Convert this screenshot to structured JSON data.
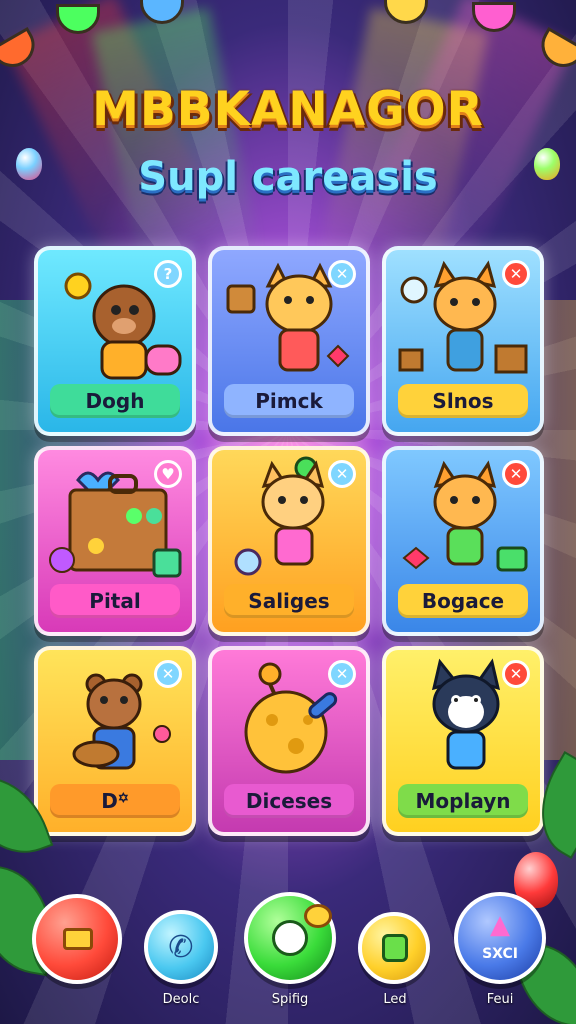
{
  "header": {
    "title": "MBBKANAGOR",
    "subtitle": "Supl careasis"
  },
  "colors": {
    "title_fill": "#ffd21f",
    "subtitle_fill": "#7ee8ff",
    "badge_blue": "#7fd6ff",
    "badge_red": "#ff4a3a",
    "badge_pink": "#ff7bd0"
  },
  "cards": [
    {
      "label": "Dogh",
      "badge": "?",
      "badge_icon": "help-icon",
      "theme": "cyan"
    },
    {
      "label": "Pimck",
      "badge": "✕",
      "badge_icon": "close-icon",
      "theme": "blue"
    },
    {
      "label": "Slnos",
      "badge": "✕",
      "badge_icon": "close-icon",
      "theme": "sky"
    },
    {
      "label": "Pital",
      "badge": "♥",
      "badge_icon": "heart-icon",
      "theme": "magenta"
    },
    {
      "label": "Saliges",
      "badge": "✕",
      "badge_icon": "close-icon",
      "theme": "orange"
    },
    {
      "label": "Bogace",
      "badge": "✕",
      "badge_icon": "close-icon",
      "theme": "azure"
    },
    {
      "label": "D꙳",
      "badge": "✕",
      "badge_icon": "close-icon",
      "theme": "yellow"
    },
    {
      "label": "Diceses",
      "badge": "✕",
      "badge_icon": "close-icon",
      "theme": "pink"
    },
    {
      "label": "Moplayn",
      "badge": "✕",
      "badge_icon": "close-icon",
      "theme": "lemon"
    }
  ],
  "nav": {
    "items": [
      {
        "label": "",
        "icon": "menu-icon"
      },
      {
        "label": "Deolc",
        "icon": "phone-icon"
      },
      {
        "label": "Spifig",
        "icon": "play-icon"
      },
      {
        "label": "Led",
        "icon": "refresh-icon"
      },
      {
        "label": "Feui",
        "icon": "upload-icon",
        "inner_text": "SXCI"
      }
    ]
  }
}
